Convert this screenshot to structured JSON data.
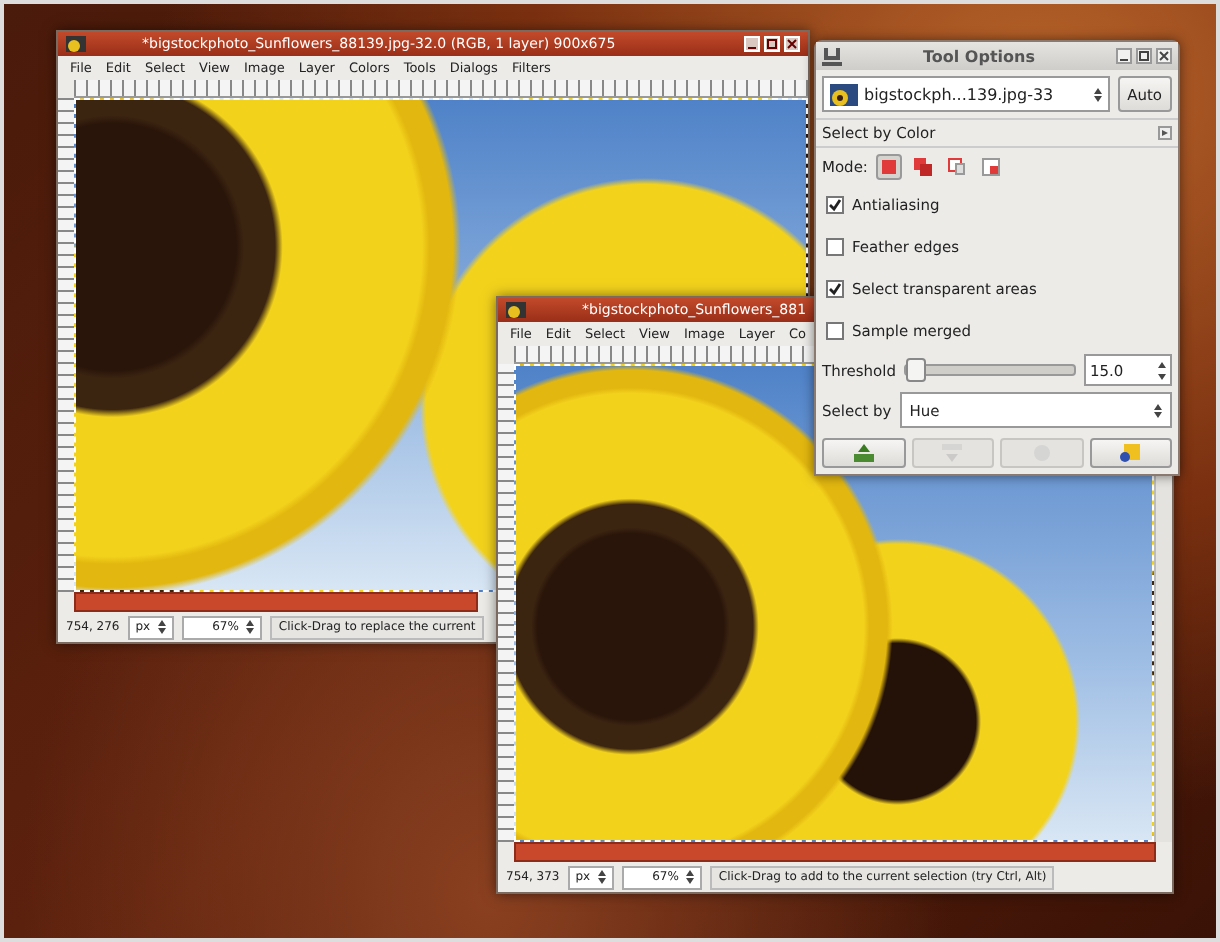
{
  "windows": [
    {
      "title": "*bigstockphoto_Sunflowers_88139.jpg-32.0 (RGB, 1 layer) 900x675",
      "menu": [
        "File",
        "Edit",
        "Select",
        "View",
        "Image",
        "Layer",
        "Colors",
        "Tools",
        "Dialogs",
        "Filters"
      ],
      "status": {
        "coords": "754, 276",
        "unit": "px",
        "zoom": "67%",
        "message": "Click-Drag to replace the current"
      }
    },
    {
      "title": "*bigstockphoto_Sunflowers_881",
      "menu": [
        "File",
        "Edit",
        "Select",
        "View",
        "Image",
        "Layer",
        "Co"
      ],
      "status": {
        "coords": "754, 373",
        "unit": "px",
        "zoom": "67%",
        "message": "Click-Drag to add to the current selection (try Ctrl, Alt)"
      }
    }
  ],
  "tool_options": {
    "title": "Tool Options",
    "image": "bigstockph...139.jpg-33",
    "auto_button": "Auto",
    "tool": "Select by Color",
    "mode_label": "Mode:",
    "modes": [
      {
        "kind": "replace",
        "selected": true
      },
      {
        "kind": "add",
        "selected": false
      },
      {
        "kind": "subtract",
        "selected": false
      },
      {
        "kind": "intersect",
        "selected": false
      }
    ],
    "options": [
      {
        "label": "Antialiasing",
        "checked": true
      },
      {
        "label": "Feather edges",
        "checked": false
      },
      {
        "label": "Select transparent areas",
        "checked": true
      },
      {
        "label": "Sample merged",
        "checked": false
      }
    ],
    "threshold": {
      "label": "Threshold",
      "level": 0.05,
      "value": "15.0"
    },
    "select_by": {
      "label": "Select by",
      "value": "Hue"
    },
    "buttons": [
      {
        "kind": "save",
        "disabled": false
      },
      {
        "kind": "restore",
        "disabled": true
      },
      {
        "kind": "delete",
        "disabled": true
      },
      {
        "kind": "reset",
        "disabled": false
      }
    ]
  }
}
